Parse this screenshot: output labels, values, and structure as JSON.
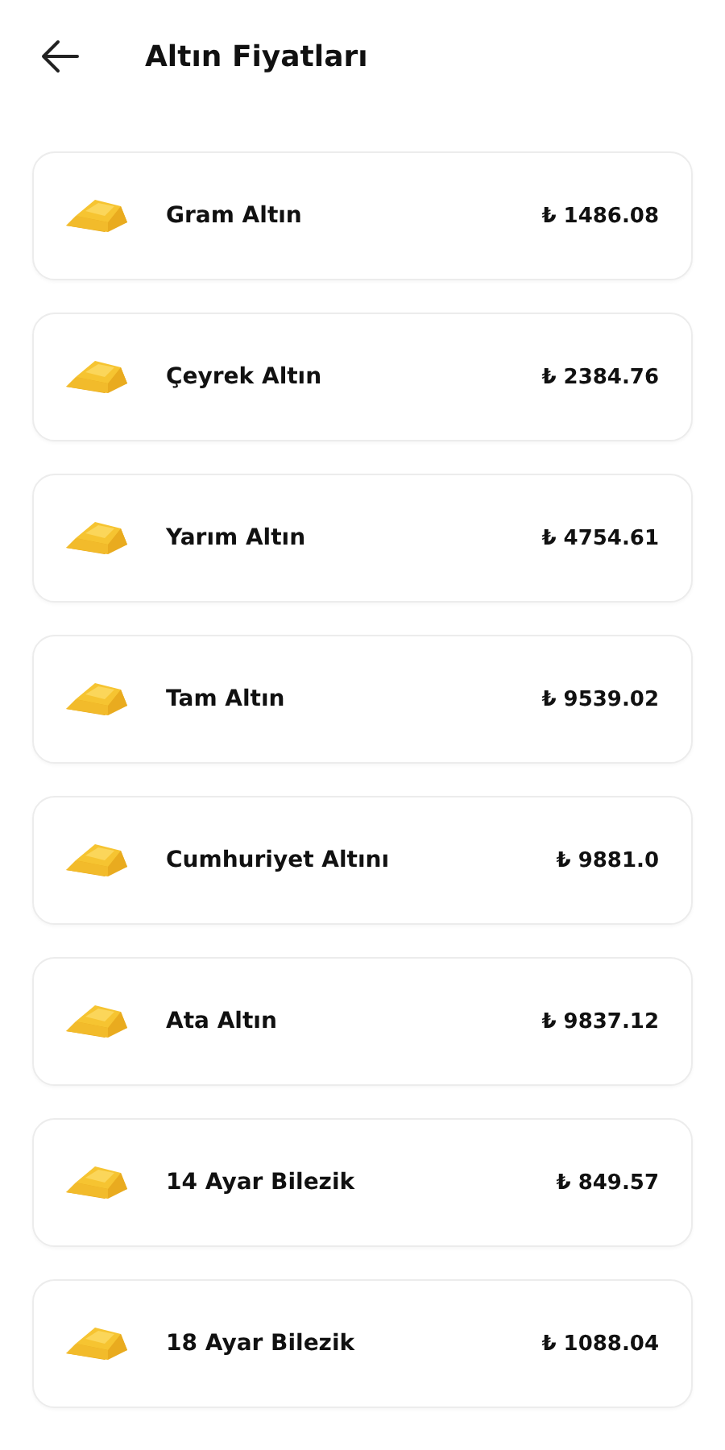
{
  "header": {
    "title": "Altın Fiyatları"
  },
  "prices": [
    {
      "name": "Gram Altın",
      "price": "₺ 1486.08"
    },
    {
      "name": "Çeyrek Altın",
      "price": "₺ 2384.76"
    },
    {
      "name": "Yarım Altın",
      "price": "₺ 4754.61"
    },
    {
      "name": "Tam Altın",
      "price": "₺ 9539.02"
    },
    {
      "name": "Cumhuriyet Altını",
      "price": "₺ 9881.0"
    },
    {
      "name": "Ata Altın",
      "price": "₺ 9837.12"
    },
    {
      "name": "14 Ayar Bilezik",
      "price": "₺ 849.57"
    },
    {
      "name": "18 Ayar Bilezik",
      "price": "₺ 1088.04"
    }
  ]
}
